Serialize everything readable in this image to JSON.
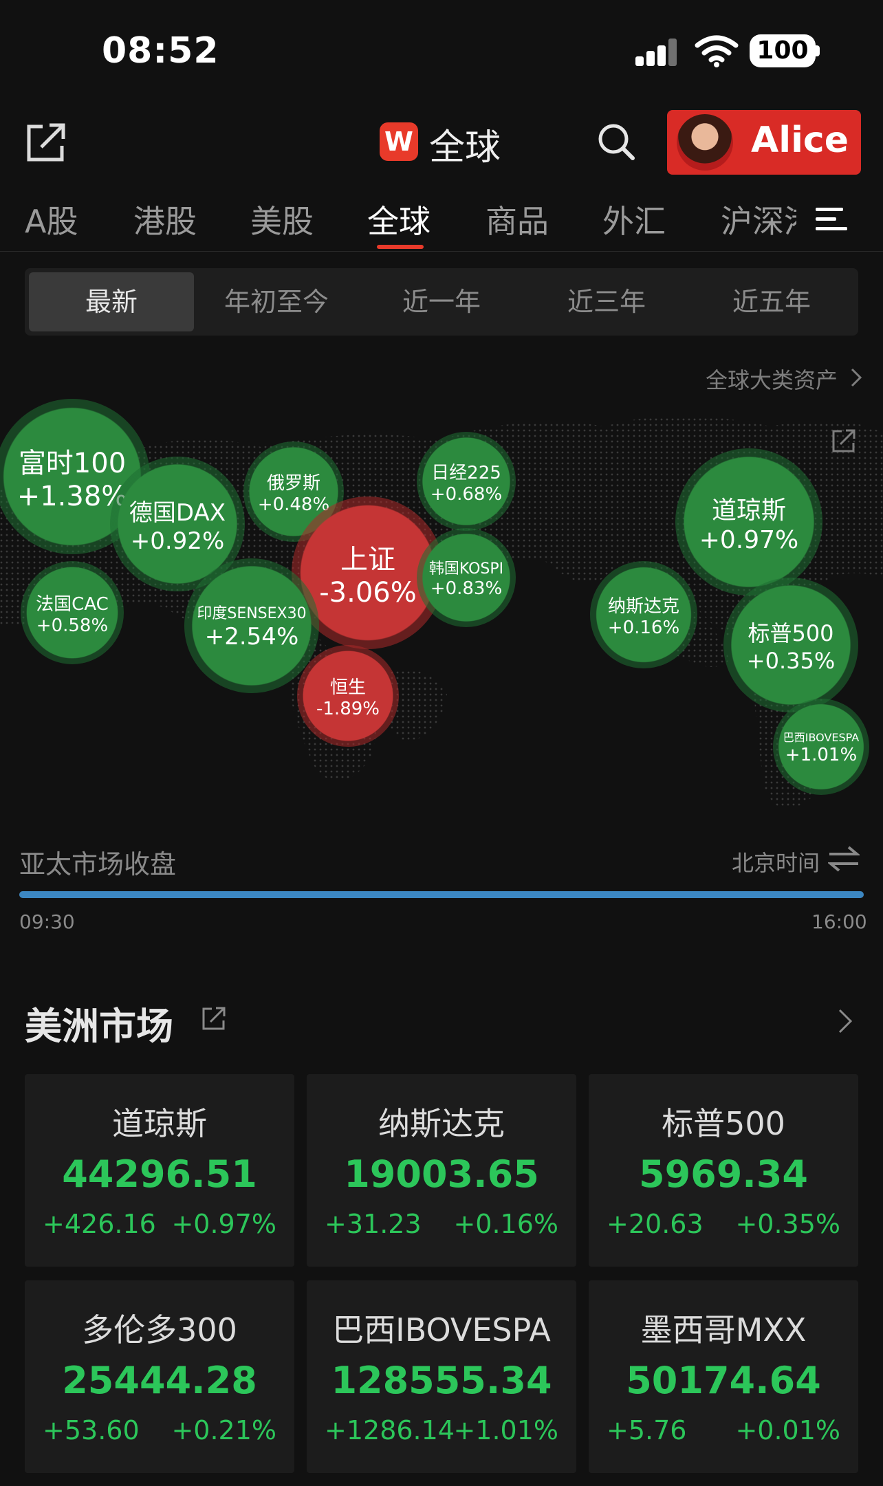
{
  "status_bar": {
    "time": "08:52",
    "battery": "100"
  },
  "header": {
    "title": "全球",
    "logo_text": "W",
    "user_name": "Alice"
  },
  "tabs": [
    "A股",
    "港股",
    "美股",
    "全球",
    "商品",
    "外汇",
    "沪深港"
  ],
  "active_tab": "全球",
  "periods": [
    "最新",
    "年初至今",
    "近一年",
    "近三年",
    "近五年"
  ],
  "active_period": "最新",
  "global_assets_link": "全球大类资产",
  "colors": {
    "up": "#2cc65a",
    "down": "#e23b3b",
    "accent": "#e83a2a",
    "progress": "#3c87c2"
  },
  "map_bubbles": [
    {
      "name": "富时100",
      "change": "+1.38%",
      "dir": "up"
    },
    {
      "name": "德国DAX",
      "change": "+0.92%",
      "dir": "up"
    },
    {
      "name": "俄罗斯",
      "change": "+0.48%",
      "dir": "up"
    },
    {
      "name": "日经225",
      "change": "+0.68%",
      "dir": "up"
    },
    {
      "name": "上证",
      "change": "-3.06%",
      "dir": "down"
    },
    {
      "name": "韩国KOSPI",
      "change": "+0.83%",
      "dir": "up"
    },
    {
      "name": "法国CAC",
      "change": "+0.58%",
      "dir": "up"
    },
    {
      "name": "印度SENSEX30",
      "change": "+2.54%",
      "dir": "up"
    },
    {
      "name": "恒生",
      "change": "-1.89%",
      "dir": "down"
    },
    {
      "name": "道琼斯",
      "change": "+0.97%",
      "dir": "up"
    },
    {
      "name": "纳斯达克",
      "change": "+0.16%",
      "dir": "up"
    },
    {
      "name": "标普500",
      "change": "+0.35%",
      "dir": "up"
    },
    {
      "name": "巴西IBOVESPA",
      "change": "+1.01%",
      "dir": "up"
    }
  ],
  "session": {
    "label": "亚太市场收盘",
    "timezone": "北京时间",
    "start": "09:30",
    "end": "16:00",
    "progress": 1.0
  },
  "americas": {
    "title": "美洲市场",
    "cards": [
      {
        "name": "道琼斯",
        "price": "44296.51",
        "change": "+426.16",
        "pct": "+0.97%"
      },
      {
        "name": "纳斯达克",
        "price": "19003.65",
        "change": "+31.23",
        "pct": "+0.16%"
      },
      {
        "name": "标普500",
        "price": "5969.34",
        "change": "+20.63",
        "pct": "+0.35%"
      },
      {
        "name": "多伦多300",
        "price": "25444.28",
        "change": "+53.60",
        "pct": "+0.21%"
      },
      {
        "name": "巴西IBOVESPA",
        "price": "128555.34",
        "change": "+1286.14",
        "pct": "+1.01%"
      },
      {
        "name": "墨西哥MXX",
        "price": "50174.64",
        "change": "+5.76",
        "pct": "+0.01%"
      }
    ]
  }
}
